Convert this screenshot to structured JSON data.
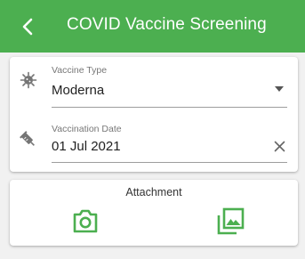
{
  "header": {
    "title": "COVID Vaccine Screening",
    "back_icon": "chevron-left-icon"
  },
  "form": {
    "vaccine_type": {
      "label": "Vaccine Type",
      "value": "Moderna",
      "icon": "virus-icon",
      "trailing_icon": "dropdown-arrow-icon"
    },
    "vaccination_date": {
      "label": "Vaccination Date",
      "value": "01 Jul 2021",
      "icon": "syringe-icon",
      "trailing_icon": "clear-icon"
    }
  },
  "attachment": {
    "title": "Attachment",
    "camera_icon": "camera-icon",
    "gallery_icon": "gallery-icon"
  },
  "colors": {
    "primary": "#4caf50",
    "icon_grey": "#757575"
  }
}
